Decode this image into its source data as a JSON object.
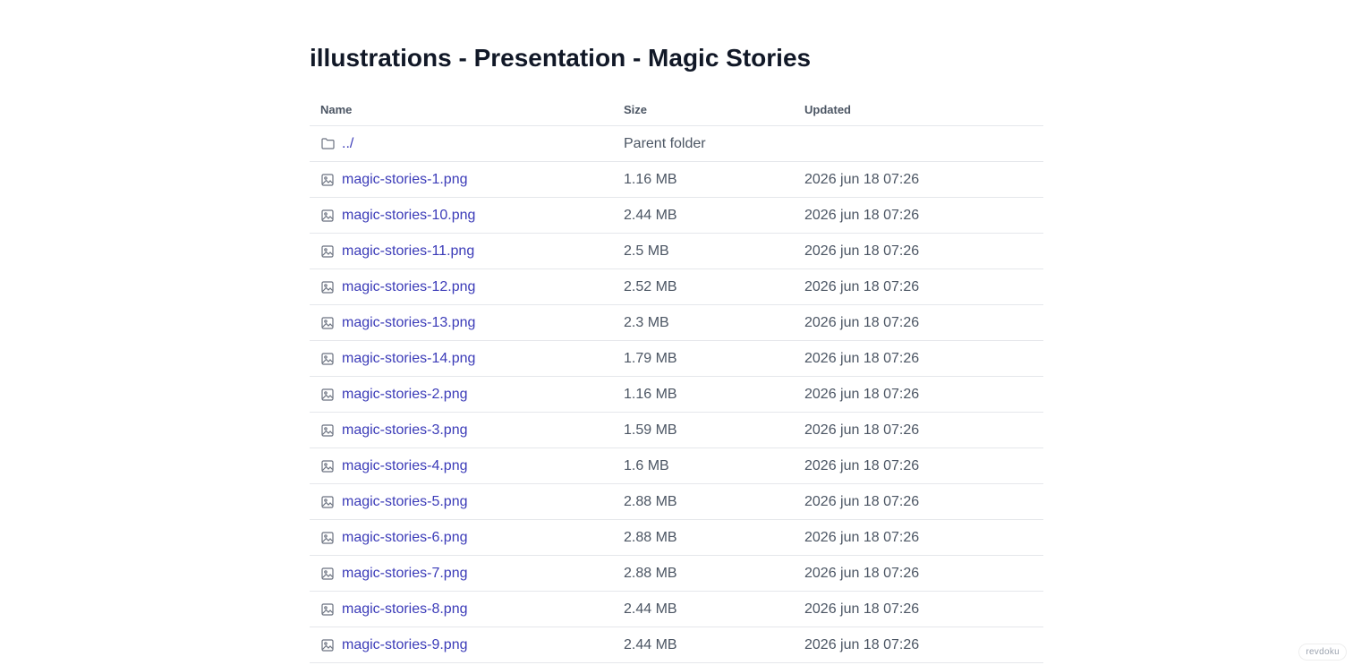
{
  "page": {
    "title": "illustrations - Presentation - Magic Stories"
  },
  "table": {
    "headers": {
      "name": "Name",
      "size": "Size",
      "updated": "Updated"
    },
    "parent": {
      "name": "../",
      "size": "Parent folder",
      "updated": "",
      "icon": "folder-icon"
    },
    "rows": [
      {
        "name": "magic-stories-1.png",
        "size": "1.16 MB",
        "updated": "2026 jun 18 07:26",
        "icon": "image-file-icon"
      },
      {
        "name": "magic-stories-10.png",
        "size": "2.44 MB",
        "updated": "2026 jun 18 07:26",
        "icon": "image-file-icon"
      },
      {
        "name": "magic-stories-11.png",
        "size": "2.5 MB",
        "updated": "2026 jun 18 07:26",
        "icon": "image-file-icon"
      },
      {
        "name": "magic-stories-12.png",
        "size": "2.52 MB",
        "updated": "2026 jun 18 07:26",
        "icon": "image-file-icon"
      },
      {
        "name": "magic-stories-13.png",
        "size": "2.3 MB",
        "updated": "2026 jun 18 07:26",
        "icon": "image-file-icon"
      },
      {
        "name": "magic-stories-14.png",
        "size": "1.79 MB",
        "updated": "2026 jun 18 07:26",
        "icon": "image-file-icon"
      },
      {
        "name": "magic-stories-2.png",
        "size": "1.16 MB",
        "updated": "2026 jun 18 07:26",
        "icon": "image-file-icon"
      },
      {
        "name": "magic-stories-3.png",
        "size": "1.59 MB",
        "updated": "2026 jun 18 07:26",
        "icon": "image-file-icon"
      },
      {
        "name": "magic-stories-4.png",
        "size": "1.6 MB",
        "updated": "2026 jun 18 07:26",
        "icon": "image-file-icon"
      },
      {
        "name": "magic-stories-5.png",
        "size": "2.88 MB",
        "updated": "2026 jun 18 07:26",
        "icon": "image-file-icon"
      },
      {
        "name": "magic-stories-6.png",
        "size": "2.88 MB",
        "updated": "2026 jun 18 07:26",
        "icon": "image-file-icon"
      },
      {
        "name": "magic-stories-7.png",
        "size": "2.88 MB",
        "updated": "2026 jun 18 07:26",
        "icon": "image-file-icon"
      },
      {
        "name": "magic-stories-8.png",
        "size": "2.44 MB",
        "updated": "2026 jun 18 07:26",
        "icon": "image-file-icon"
      },
      {
        "name": "magic-stories-9.png",
        "size": "2.44 MB",
        "updated": "2026 jun 18 07:26",
        "icon": "image-file-icon"
      }
    ]
  },
  "footer": {
    "badge": "revdoku"
  },
  "colors": {
    "link": "#3b3bb8",
    "text": "#111827",
    "muted": "#4b5563",
    "border": "#e5e7eb"
  }
}
